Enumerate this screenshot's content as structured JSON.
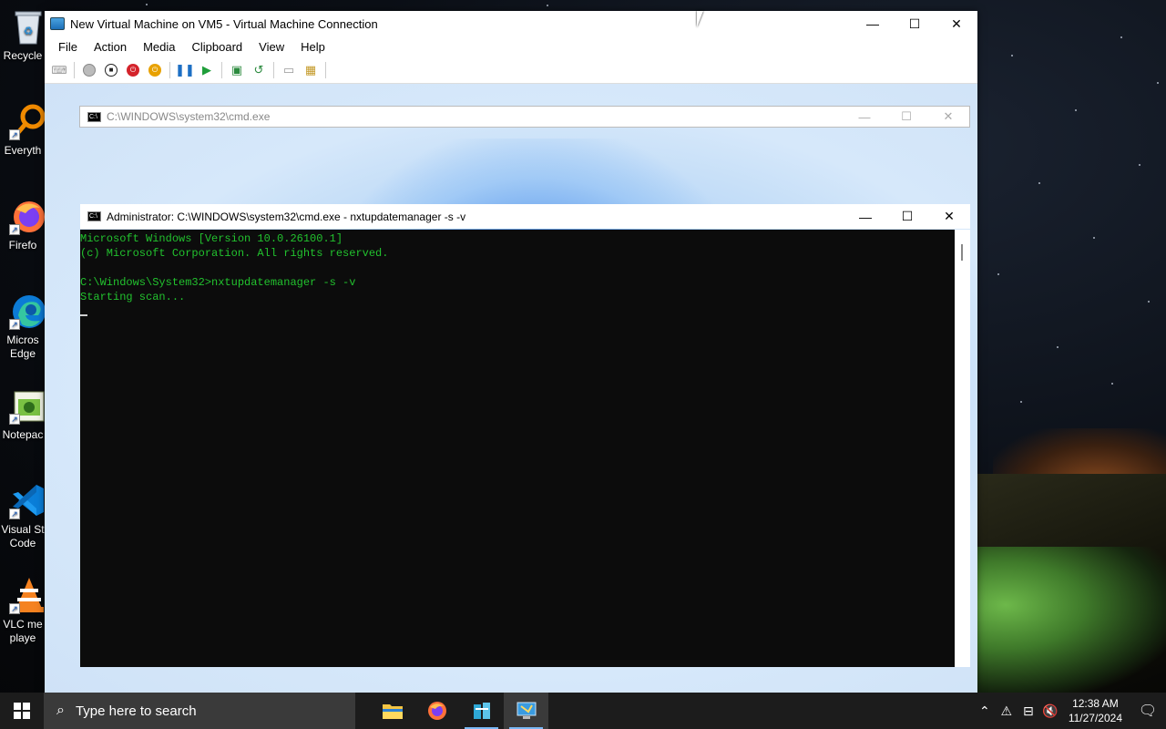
{
  "desktop": {
    "icons": [
      {
        "label": "Recycle",
        "icon": "recycle-bin-icon"
      },
      {
        "label": "Everyth",
        "icon": "everything-icon"
      },
      {
        "label": "Firefo",
        "icon": "firefox-icon"
      },
      {
        "label": "Micros\nEdge",
        "icon": "edge-icon"
      },
      {
        "label": "Notepac",
        "icon": "notepad-icon"
      },
      {
        "label": "Visual St\nCode",
        "icon": "vscode-icon"
      },
      {
        "label": "VLC me\nplaye",
        "icon": "vlc-icon"
      }
    ]
  },
  "vm_window": {
    "title": "New Virtual Machine on VM5 - Virtual Machine Connection",
    "menu": [
      "File",
      "Action",
      "Media",
      "Clipboard",
      "View",
      "Help"
    ],
    "controls": {
      "minimize": "—",
      "maximize": "☐",
      "close": "✕"
    }
  },
  "cmd_back": {
    "title": "C:\\WINDOWS\\system32\\cmd.exe"
  },
  "cmd_front": {
    "title": "Administrator: C:\\WINDOWS\\system32\\cmd.exe - nxtupdatemanager  -s -v",
    "lines": [
      "Microsoft Windows [Version 10.0.26100.1]",
      "(c) Microsoft Corporation. All rights reserved.",
      "",
      "C:\\Windows\\System32>nxtupdatemanager -s -v",
      "Starting scan..."
    ]
  },
  "taskbar": {
    "search_placeholder": "Type here to search",
    "apps": [
      "file-explorer-icon",
      "firefox-icon",
      "app-icon",
      "hyperv-icon"
    ],
    "clock_time": "12:38 AM",
    "clock_date": "11/27/2024"
  },
  "colors": {
    "console_text": "#22c22e",
    "taskbar": "#1c1c1c"
  }
}
